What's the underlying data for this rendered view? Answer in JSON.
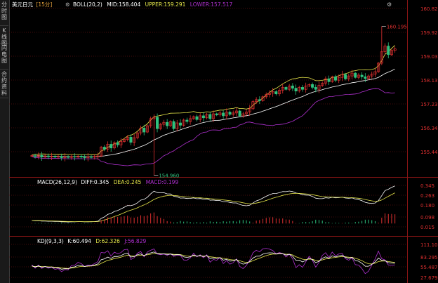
{
  "sidebar": {
    "tabs": [
      {
        "label": "分时图",
        "active": false
      },
      {
        "label": "K线图",
        "active": true
      },
      {
        "label": "闪电图",
        "active": false
      },
      {
        "label": "合约资料",
        "active": false
      }
    ]
  },
  "main_panel": {
    "symbol": "美元日元",
    "period": "[15分]",
    "settings_icon": "gear-icon",
    "indicator_label": "BOLL(20,2)",
    "mid_label": "MID:158.404",
    "upper_label": "UPPER:159.291",
    "lower_label": "LOWER:157.517"
  },
  "macd_panel": {
    "indicator_label": "MACD(26,12,9)",
    "diff_label": "DIFF:0.345",
    "dea_label": "DEA:0.245",
    "macd_label": "MACD:0.199"
  },
  "kdj_panel": {
    "indicator_label": "KDJ(9,3,3)",
    "k_label": "K:60.494",
    "d_label": "D:62.326",
    "j_label": "J:56.829"
  },
  "colors": {
    "up": "#e03030",
    "down": "#2ec27e",
    "mid": "#ffffff",
    "upper": "#e6e64a",
    "lower": "#b030d0",
    "axis_text": "#e03030",
    "grid": "#5a1010"
  },
  "chart_data": [
    {
      "type": "candlestick",
      "y_ticks": [
        "160.823",
        "159.927",
        "159.031",
        "158.135",
        "157.239",
        "156.342",
        "155.446"
      ],
      "ylim": [
        155.0,
        160.823
      ],
      "annotations": [
        {
          "label": "160.195",
          "value": 160.195,
          "kind": "high"
        },
        {
          "label": "154.960",
          "value": 154.96,
          "kind": "low"
        }
      ],
      "start_price": 155.64,
      "closes": [
        155.65,
        155.62,
        155.66,
        155.6,
        155.64,
        155.61,
        155.63,
        155.6,
        155.62,
        155.58,
        155.61,
        155.59,
        155.62,
        155.6,
        155.63,
        155.6,
        155.58,
        155.61,
        155.6,
        155.62,
        155.64,
        155.95,
        155.88,
        156.05,
        155.92,
        156.1,
        156.03,
        156.15,
        156.22,
        156.3,
        156.12,
        156.28,
        156.45,
        156.62,
        156.48,
        156.7,
        156.95,
        157.0,
        156.6,
        156.75,
        156.82,
        156.7,
        156.85,
        156.6,
        156.8,
        156.72,
        156.9,
        156.85,
        156.95,
        157.02,
        156.92,
        157.05,
        156.98,
        157.1,
        156.95,
        157.12,
        157.08,
        157.15,
        157.05,
        157.18,
        157.1,
        157.15,
        157.22,
        157.05,
        157.12,
        157.18,
        157.3,
        157.55,
        157.62,
        157.58,
        157.72,
        157.8,
        157.85,
        157.9,
        157.82,
        157.95,
        158.05,
        157.98,
        158.1,
        158.02,
        157.92,
        158.05,
        157.98,
        158.1,
        158.15,
        158.05,
        157.98,
        158.12,
        158.2,
        158.35,
        158.25,
        158.42,
        158.3,
        158.4,
        158.5,
        158.35,
        158.45,
        158.55,
        158.4,
        158.48,
        158.42,
        158.36,
        158.45,
        158.52,
        158.6,
        158.9,
        159.3,
        159.5,
        159.2,
        159.35,
        159.4
      ]
    },
    {
      "type": "macd",
      "y_ticks": [
        "0.345",
        "0.263",
        "0.180",
        "0.098",
        "0.015"
      ],
      "ylim": [
        -0.02,
        0.345
      ]
    },
    {
      "type": "kdj",
      "y_ticks": [
        "111.103",
        "83.295",
        "55.487",
        "27.679"
      ],
      "ylim": [
        10,
        111.103
      ]
    }
  ]
}
